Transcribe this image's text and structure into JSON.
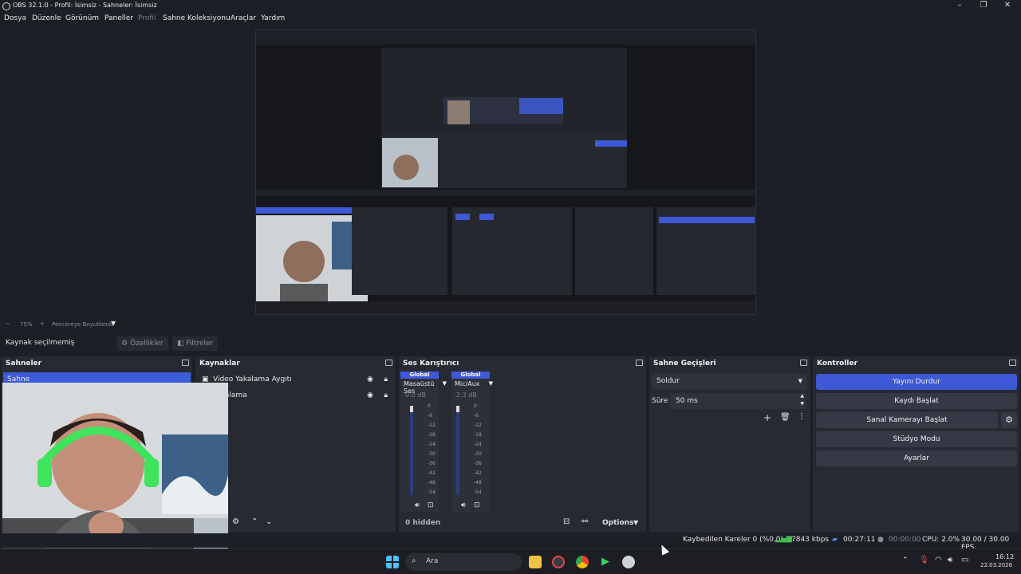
{
  "window": {
    "title": "OBS 32.1.0 - Profil: İsimsiz - Sahneler: İsimsiz"
  },
  "menu": [
    "Dosya",
    "Düzenle",
    "Görünüm",
    "Paneller",
    "Profil",
    "Sahne Koleksiyonu",
    "Araçlar",
    "Yardım"
  ],
  "zoom": {
    "level": "75%",
    "fit_label": "Pencereye Boyutlandır"
  },
  "source_toolbar": {
    "no_selection": "Kaynak seçilmemiş",
    "properties": "Özellikler",
    "filters": "Filtreler"
  },
  "scenes": {
    "title": "Sahneler",
    "items": [
      "Sahne"
    ]
  },
  "sources": {
    "title": "Kaynaklar",
    "items": [
      "Video Yakalama Aygıtı",
      "Yakalama"
    ]
  },
  "mixer": {
    "title": "Ses Karıştırıcı",
    "channels": [
      {
        "tag": "Global",
        "name": "Masaüstü Ses",
        "db": "0.0 dB"
      },
      {
        "tag": "Global",
        "name": "Mic/Aux",
        "db": "2.3 dB"
      }
    ],
    "scale": [
      "0",
      "-6",
      "-12",
      "-18",
      "-24",
      "-30",
      "-36",
      "-42",
      "-48",
      "-54",
      "-60"
    ],
    "hidden": "0 hidden",
    "options": "Options"
  },
  "transitions": {
    "title": "Sahne Geçişleri",
    "selected": "Soldur",
    "duration_label": "Süre",
    "duration_value": "50 ms"
  },
  "controls": {
    "title": "Kontroller",
    "stop_stream": "Yayını Durdur",
    "start_record": "Kaydı Başlat",
    "start_vcam": "Sanal Kamerayı Başlat",
    "studio_mode": "Stüdyo Modu",
    "settings": "Ayarlar"
  },
  "status": {
    "dropped_frames": "Kaybedilen Kareler 0 (%0.0)",
    "bitrate": "7843 kbps",
    "stream_time": "00:27:11",
    "record_time": "00:00:00",
    "cpu": "CPU: 2.0%",
    "fps": "30.00 / 30.00 FPS"
  },
  "taskbar": {
    "search_placeholder": "Ara",
    "time": "16:12",
    "date": "22.03.2026"
  },
  "colors": {
    "accent": "#3e58d6",
    "panel": "#272a33",
    "background": "#1d1f26"
  }
}
